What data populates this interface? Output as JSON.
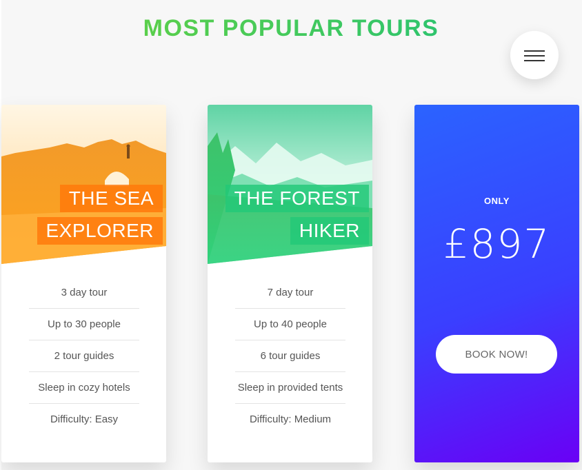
{
  "page": {
    "title": "MOST POPULAR TOURS"
  },
  "menu": {
    "icon": "hamburger-menu-icon"
  },
  "cards": [
    {
      "heading_line1": "THE SEA",
      "heading_line2": "EXPLORER",
      "accent": "#ff8a00",
      "details": [
        "3 day tour",
        "Up to 30 people",
        "2 tour guides",
        "Sleep in cozy hotels",
        "Difficulty: Easy"
      ]
    },
    {
      "heading_line1": "THE FOREST",
      "heading_line2": "HIKER",
      "accent": "#1fc27a",
      "details": [
        "7 day tour",
        "Up to 40 people",
        "6 tour guides",
        "Sleep in provided tents",
        "Difficulty: Medium"
      ]
    }
  ],
  "price_card": {
    "only_label": "ONLY",
    "price": "£897",
    "button_label": "BOOK NOW!",
    "gradient_start": "#2b63ff",
    "gradient_end": "#6a00f5"
  }
}
